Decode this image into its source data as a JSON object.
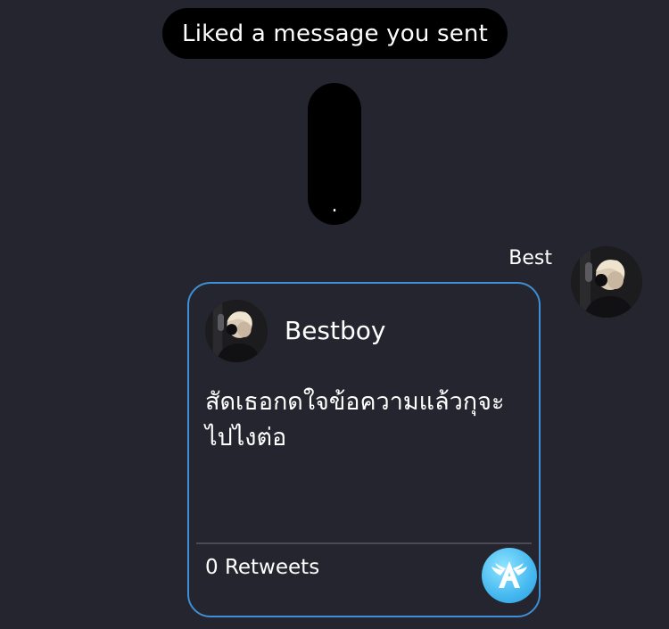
{
  "notification": {
    "liked_text": "Liked a message you sent"
  },
  "dot_message": {
    "text": "."
  },
  "sender": {
    "name": "Best",
    "avatar_icon": "user-avatar"
  },
  "shared_card": {
    "username": "Bestboy",
    "avatar_icon": "user-avatar",
    "text": "สัดเธอกดใจข้อความแล้วกุจะไปไงต่อ",
    "retweets_label": "0 Retweets",
    "app_icon": "winged-a-app-icon",
    "border_color": "#3d8fd6"
  },
  "colors": {
    "background": "#24252e",
    "bubble": "#000000",
    "accent": "#3d8fd6"
  }
}
